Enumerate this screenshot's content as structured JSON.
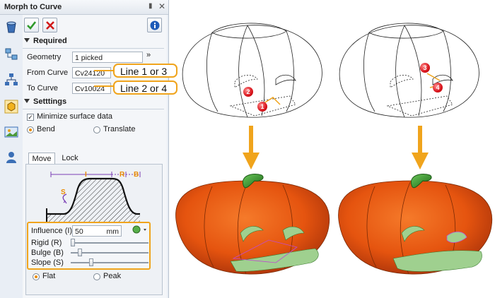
{
  "dialog": {
    "title": "Morph to Curve",
    "toolbar": {
      "ok_icon": "check-icon",
      "cancel_icon": "x-icon",
      "info_icon": "info-icon"
    },
    "required": {
      "header": "Required",
      "geometry_label": "Geometry",
      "geometry_value": "1 picked",
      "from_curve_label": "From Curve",
      "from_curve_value": "Cv24120",
      "to_curve_label": "To Curve",
      "to_curve_value": "Cv10024"
    },
    "settings": {
      "header": "Setttings",
      "minimize_label": "Minimize surface data",
      "minimize_checked": true,
      "bend_label": "Bend",
      "translate_label": "Translate",
      "selected_mode": "Bend",
      "tabs": [
        "Move",
        "Lock"
      ],
      "active_tab": "Move",
      "diagram_labels": {
        "i": "I",
        "r": "R",
        "b": "B",
        "s": "S"
      },
      "influence_label": "Influence (I)",
      "influence_value": "50",
      "influence_unit": "mm",
      "rigid_label": "Rigid (R)",
      "rigid_level": 0.0,
      "bulge_label": "Bulge (B)",
      "bulge_level": 0.1,
      "slope_label": "Slope (S)",
      "slope_level": 0.25,
      "flat_label": "Flat",
      "peak_label": "Peak",
      "selected_shape": "Flat"
    }
  },
  "callouts": {
    "from": "Line 1 or 3",
    "to": "Line 2 or 4"
  },
  "markers": [
    "1",
    "2",
    "3",
    "4"
  ],
  "colors": {
    "accent": "#f0a41c",
    "pumpkin": "#e5540f",
    "stem": "#2f9a2a",
    "marker": "#d8141c",
    "face": "#9fd08f"
  }
}
